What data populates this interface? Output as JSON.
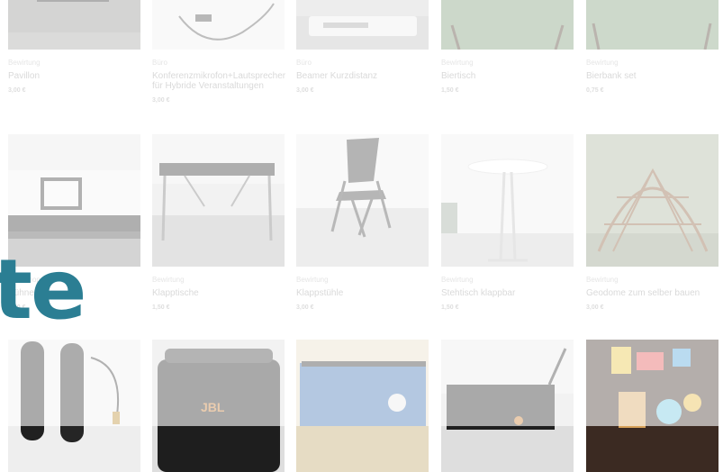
{
  "overlay": {
    "text": "te"
  },
  "products": [
    {
      "category": "Bewirtung",
      "title": "Pavillon",
      "price": "3,00 €",
      "image": "pavilion-image"
    },
    {
      "category": "Büro",
      "title": "Konferenzmikrofon+Lautsprecher für Hybride Veranstaltungen",
      "price": "3,00 €",
      "image": "conference-microphone-image"
    },
    {
      "category": "Büro",
      "title": "Beamer Kurzdistanz",
      "price": "3,00 €",
      "image": "short-throw-projector-image"
    },
    {
      "category": "Bewirtung",
      "title": "Biertisch",
      "price": "1,50 €",
      "image": "beer-table-image"
    },
    {
      "category": "Bewirtung",
      "title": "Bierbank set",
      "price": "0,75 €",
      "image": "beer-bench-image"
    },
    {
      "category": "Workshop",
      "title": "Bühne",
      "price": "3,00 €",
      "image": "stage-image"
    },
    {
      "category": "Bewirtung",
      "title": "Klapptische",
      "price": "1,50 €",
      "image": "folding-table-image"
    },
    {
      "category": "Bewirtung",
      "title": "Klappstühle",
      "price": "3,00 €",
      "image": "folding-chair-image"
    },
    {
      "category": "Bewirtung",
      "title": "Stehtisch klappbar",
      "price": "1,50 €",
      "image": "standing-table-image"
    },
    {
      "category": "Bewirtung",
      "title": "Geodome zum selber bauen",
      "price": "3,00 €",
      "image": "geodome-image"
    },
    {
      "image": "microphones-image"
    },
    {
      "image": "speaker-image"
    },
    {
      "image": "cutting-board-image"
    },
    {
      "image": "cart-image"
    },
    {
      "image": "craft-case-image"
    }
  ]
}
